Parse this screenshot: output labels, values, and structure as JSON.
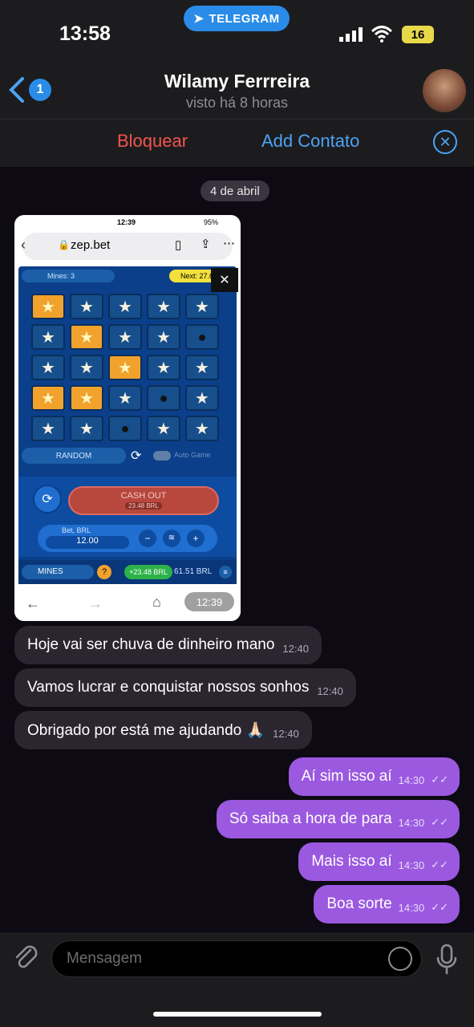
{
  "status": {
    "time": "13:58",
    "telegram": "TELEGRAM",
    "battery": "16"
  },
  "header": {
    "back_count": "1",
    "name": "Wilamy Ferrreira",
    "last_seen": "visto há 8 horas"
  },
  "actions": {
    "block": "Bloquear",
    "add_contact": "Add Contato"
  },
  "date_badge": "4 de abril",
  "screenshot": {
    "phone_time": "12:39",
    "phone_battery": "95%",
    "url": "zep.bet",
    "mines_label": "Mines: 3",
    "next_label": "Next: 27.62",
    "random": "RANDOM",
    "auto_game": "Auto Game",
    "cash_out": "CASH OUT",
    "cash_out_amount": "23.48 BRL",
    "bet_label": "Bet, BRL",
    "bet_value": "12.00",
    "game_select": "MINES",
    "profit": "+23.48 BRL",
    "balance": "61.51 BRL",
    "overlay_time": "12:39",
    "grid": [
      [
        "gold",
        "star",
        "star",
        "star",
        "star"
      ],
      [
        "star",
        "gold",
        "star",
        "star",
        "bomb"
      ],
      [
        "star",
        "star",
        "gold",
        "star",
        "star"
      ],
      [
        "gold",
        "gold",
        "star",
        "bomb",
        "star"
      ],
      [
        "star",
        "star",
        "bomb",
        "star",
        "star"
      ]
    ]
  },
  "incoming": [
    {
      "text": "Hoje vai ser chuva de dinheiro mano",
      "time": "12:40"
    },
    {
      "text": "Vamos lucrar e conquistar nossos sonhos",
      "time": "12:40"
    },
    {
      "text": "Obrigado por está me ajudando 🙏🏻",
      "time": "12:40"
    }
  ],
  "outgoing": [
    {
      "text": "Aí sim isso aí",
      "time": "14:30"
    },
    {
      "text": "Só saiba a hora de para",
      "time": "14:30"
    },
    {
      "text": "Mais isso aí",
      "time": "14:30"
    },
    {
      "text": "Boa sorte",
      "time": "14:30"
    }
  ],
  "input": {
    "placeholder": "Mensagem"
  }
}
